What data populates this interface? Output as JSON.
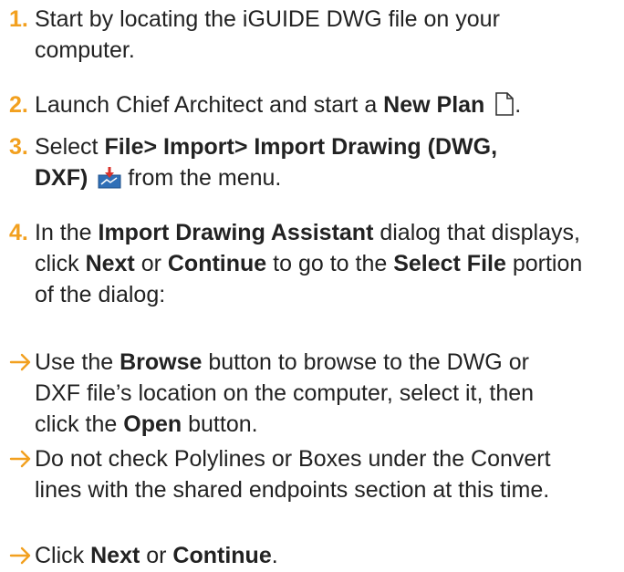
{
  "accent_color": "#f2a01f",
  "steps": [
    {
      "number": "1.",
      "text": "Start by locating the iGUIDE DWG file on your computer."
    },
    {
      "number": "2.",
      "pre": "Launch Chief Architect and start a ",
      "bold": "New Plan",
      "post": ".",
      "icon": "new-document-icon"
    },
    {
      "number": "3.",
      "pre": "Select ",
      "bold": "File> Import> Import Drawing (DWG, DXF)",
      "post": " from the menu.",
      "icon": "import-drawing-icon"
    },
    {
      "number": "4.",
      "pre": "In the ",
      "bold1": "Import Drawing Assistant",
      "mid1": " dialog that displays, click ",
      "bold2": "Next",
      "mid2": " or ",
      "bold3": "Continue",
      "mid3": " to go to the ",
      "bold4": "Select File",
      "post": " portion of the dialog:"
    }
  ],
  "bullets": [
    {
      "icon": "arrow-right-icon",
      "pre": "Use the ",
      "bold1": "Browse",
      "mid": " button to browse to the DWG or DXF file’s location on the computer, select it, then click the ",
      "bold2": "Open",
      "post": " button."
    },
    {
      "icon": "arrow-right-icon",
      "text": "Do not check Polylines or Boxes under the Convert lines with the shared endpoints section at this time."
    },
    {
      "icon": "arrow-right-icon",
      "pre": "Click ",
      "bold1": "Next",
      "mid": " or ",
      "bold2": "Continue",
      "post": "."
    }
  ]
}
